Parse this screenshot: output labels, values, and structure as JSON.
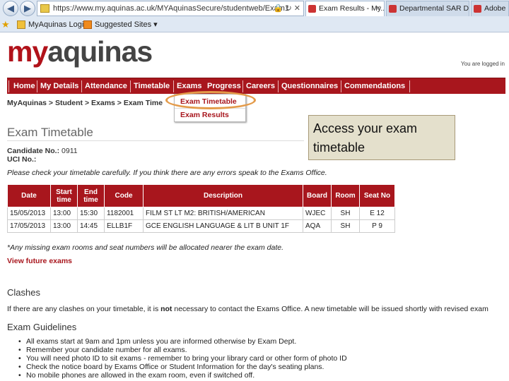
{
  "browser": {
    "url": "https://www.my.aquinas.ac.uk/MYAquinasSecure/studentweb/Exam1",
    "tabs": [
      "Exam Results - My...",
      "Departmental SAR Do...",
      "Adobe I"
    ],
    "favorites": [
      "MyAquinas Login",
      "Suggested Sites ▾"
    ]
  },
  "logo": {
    "my": "my",
    "rest": "aquinas"
  },
  "logged_in": "You are logged in",
  "menu": [
    "Home",
    "My Details",
    "Attendance",
    "Timetable",
    "Exams",
    "Progress",
    "Careers",
    "Questionnaires",
    "Commendations"
  ],
  "breadcrumb": "MyAquinas > Student > Exams > Exam Time",
  "dropdown": [
    "Exam Timetable",
    "Exam Results"
  ],
  "callout": "Access your exam timetable",
  "page_title": "Exam Timetable",
  "candidate": {
    "label": "Candidate No.:",
    "value": "0911"
  },
  "uci": {
    "label": "UCI No.:",
    "value": ""
  },
  "warning": "Please check your timetable carefully. If you think there are any errors speak to the Exams Office.",
  "table": {
    "headers": [
      "Date",
      "Start time",
      "End time",
      "Code",
      "Description",
      "Board",
      "Room",
      "Seat No"
    ],
    "rows": [
      [
        "15/05/2013",
        "13:00",
        "15:30",
        "1182001",
        "FILM ST LT M2: BRITISH/AMERICAN",
        "WJEC",
        "SH",
        "E 12"
      ],
      [
        "17/05/2013",
        "13:00",
        "14:45",
        "ELLB1F",
        "GCE ENGLISH LANGUAGE & LIT B UNIT 1F",
        "AQA",
        "SH",
        "P 9"
      ]
    ]
  },
  "note": "*Any missing exam rooms and seat numbers will be allocated nearer the exam date.",
  "view_future": "View future exams",
  "clashes": {
    "title": "Clashes",
    "text_a": "If there are any clashes on your timetable, it is ",
    "text_b": "not",
    "text_c": " necessary to contact the Exams Office. A new timetable will be issued shortly with revised exam"
  },
  "guidelines": {
    "title": "Exam Guidelines",
    "items": [
      "All exams start at 9am and 1pm unless you are informed otherwise by Exam Dept.",
      "Remember your candidate number for all exams.",
      "You will need photo ID to sit exams - remember to bring your library card or other form of photo ID",
      "Check the notice board by Exams Office or Student Information for the day's seating plans.",
      "No mobile phones are allowed in the exam room, even if switched off."
    ]
  },
  "colors": {
    "brand_red": "#a8161d",
    "callout_bg": "#e4e0cc",
    "highlight": "#e49b4a"
  }
}
